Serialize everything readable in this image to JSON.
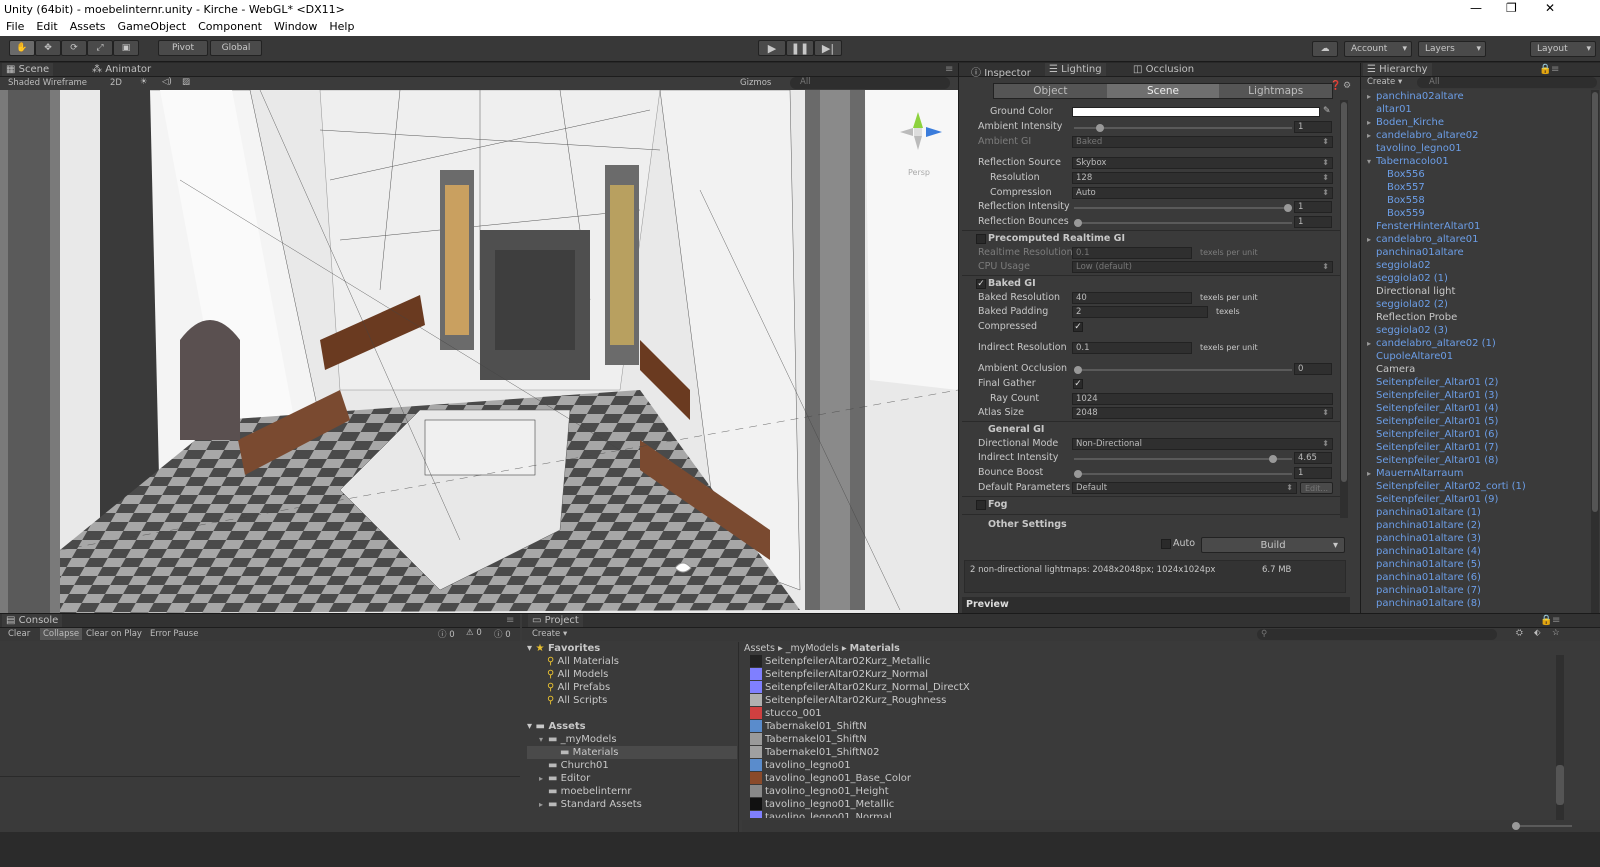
{
  "window": {
    "title": "Unity (64bit) - moebelinternr.unity - Kirche - WebGL* <DX11>"
  },
  "menu": [
    "File",
    "Edit",
    "Assets",
    "GameObject",
    "Component",
    "Window",
    "Help"
  ],
  "toolbar": {
    "pivot": "Pivot",
    "global": "Global",
    "account": "Account",
    "layers": "Layers",
    "layout": "Layout"
  },
  "scene": {
    "tab": "Scene",
    "tab2": "Animator",
    "mode": "Shaded Wireframe",
    "mode2d": "2D",
    "gizmos": "Gizmos",
    "search": "All",
    "persp": "Persp"
  },
  "inspector": {
    "tabs": [
      "Inspector",
      "Lighting",
      "Occlusion"
    ],
    "subtabs": [
      "Object",
      "Scene",
      "Lightmaps"
    ],
    "ground_color": "Ground Color",
    "ambient_intensity": {
      "label": "Ambient Intensity",
      "value": "1"
    },
    "ambient_gi": {
      "label": "Ambient GI",
      "value": "Baked"
    },
    "reflection_source": {
      "label": "Reflection Source",
      "value": "Skybox"
    },
    "resolution": {
      "label": "Resolution",
      "value": "128"
    },
    "compression": {
      "label": "Compression",
      "value": "Auto"
    },
    "reflection_intensity": {
      "label": "Reflection Intensity",
      "value": "1"
    },
    "reflection_bounces": {
      "label": "Reflection Bounces",
      "value": "1"
    },
    "precomputed": "Precomputed Realtime GI",
    "realtime_resolution": {
      "label": "Realtime Resolution",
      "value": "0.1",
      "unit": "texels per unit"
    },
    "cpu_usage": {
      "label": "CPU Usage",
      "value": "Low (default)"
    },
    "baked_gi": "Baked GI",
    "baked_resolution": {
      "label": "Baked Resolution",
      "value": "40",
      "unit": "texels per unit"
    },
    "baked_padding": {
      "label": "Baked Padding",
      "value": "2",
      "unit": "texels"
    },
    "compressed": "Compressed",
    "indirect_resolution": {
      "label": "Indirect Resolution",
      "value": "0.1",
      "unit": "texels per unit"
    },
    "ambient_occlusion": {
      "label": "Ambient Occlusion",
      "value": "0"
    },
    "final_gather": "Final Gather",
    "ray_count": {
      "label": "Ray Count",
      "value": "1024"
    },
    "atlas_size": {
      "label": "Atlas Size",
      "value": "2048"
    },
    "general_gi": "General GI",
    "directional_mode": {
      "label": "Directional Mode",
      "value": "Non-Directional"
    },
    "indirect_intensity": {
      "label": "Indirect Intensity",
      "value": "4.65"
    },
    "bounce_boost": {
      "label": "Bounce Boost",
      "value": "1"
    },
    "default_parameters": {
      "label": "Default Parameters",
      "value": "Default",
      "edit": "Edit..."
    },
    "fog": "Fog",
    "other_settings": "Other Settings",
    "auto": "Auto",
    "build": "Build",
    "status": "2 non-directional lightmaps: 2048x2048px; 1024x1024px",
    "size": "6.7 MB",
    "preview": "Preview"
  },
  "hierarchy": {
    "tab": "Hierarchy",
    "create": "Create",
    "search": "All",
    "items": [
      {
        "label": "panchina02altare",
        "color": "#6c9ee7",
        "indent": 0,
        "arrow": true
      },
      {
        "label": "altar01",
        "color": "#6c9ee7",
        "indent": 0,
        "arrow": false
      },
      {
        "label": "Boden_Kirche",
        "color": "#6c9ee7",
        "indent": 0,
        "arrow": true
      },
      {
        "label": "candelabro_altare02",
        "color": "#6c9ee7",
        "indent": 0,
        "arrow": true
      },
      {
        "label": "tavolino_legno01",
        "color": "#6c9ee7",
        "indent": 0,
        "arrow": false
      },
      {
        "label": "Tabernacolo01",
        "color": "#6c9ee7",
        "indent": 0,
        "arrow": "open"
      },
      {
        "label": "Box556",
        "color": "#6c9ee7",
        "indent": 1,
        "arrow": false
      },
      {
        "label": "Box557",
        "color": "#6c9ee7",
        "indent": 1,
        "arrow": false
      },
      {
        "label": "Box558",
        "color": "#6c9ee7",
        "indent": 1,
        "arrow": false
      },
      {
        "label": "Box559",
        "color": "#6c9ee7",
        "indent": 1,
        "arrow": false
      },
      {
        "label": "FensterHinterAltar01",
        "color": "#6c9ee7",
        "indent": 0,
        "arrow": false
      },
      {
        "label": "candelabro_altare01",
        "color": "#6c9ee7",
        "indent": 0,
        "arrow": true
      },
      {
        "label": "panchina01altare",
        "color": "#6c9ee7",
        "indent": 0,
        "arrow": false
      },
      {
        "label": "seggiola02",
        "color": "#6c9ee7",
        "indent": 0,
        "arrow": false
      },
      {
        "label": "seggiola02 (1)",
        "color": "#6c9ee7",
        "indent": 0,
        "arrow": false
      },
      {
        "label": "Directional light",
        "color": "#c8c8c8",
        "indent": 0,
        "arrow": false
      },
      {
        "label": "seggiola02 (2)",
        "color": "#6c9ee7",
        "indent": 0,
        "arrow": false
      },
      {
        "label": "Reflection Probe",
        "color": "#c8c8c8",
        "indent": 0,
        "arrow": false
      },
      {
        "label": "seggiola02 (3)",
        "color": "#6c9ee7",
        "indent": 0,
        "arrow": false
      },
      {
        "label": "candelabro_altare02 (1)",
        "color": "#6c9ee7",
        "indent": 0,
        "arrow": true
      },
      {
        "label": "CupoleAltare01",
        "color": "#6c9ee7",
        "indent": 0,
        "arrow": false
      },
      {
        "label": "Camera",
        "color": "#c8c8c8",
        "indent": 0,
        "arrow": false
      },
      {
        "label": "Seitenpfeiler_Altar01 (2)",
        "color": "#6c9ee7",
        "indent": 0,
        "arrow": false
      },
      {
        "label": "Seitenpfeiler_Altar01 (3)",
        "color": "#6c9ee7",
        "indent": 0,
        "arrow": false
      },
      {
        "label": "Seitenpfeiler_Altar01 (4)",
        "color": "#6c9ee7",
        "indent": 0,
        "arrow": false
      },
      {
        "label": "Seitenpfeiler_Altar01 (5)",
        "color": "#6c9ee7",
        "indent": 0,
        "arrow": false
      },
      {
        "label": "Seitenpfeiler_Altar01 (6)",
        "color": "#6c9ee7",
        "indent": 0,
        "arrow": false
      },
      {
        "label": "Seitenpfeiler_Altar01 (7)",
        "color": "#6c9ee7",
        "indent": 0,
        "arrow": false
      },
      {
        "label": "Seitenpfeiler_Altar01 (8)",
        "color": "#6c9ee7",
        "indent": 0,
        "arrow": false
      },
      {
        "label": "MauernAltarraum",
        "color": "#6c9ee7",
        "indent": 0,
        "arrow": true
      },
      {
        "label": "Seitenpfeiler_Altar02_corti (1)",
        "color": "#6c9ee7",
        "indent": 0,
        "arrow": false
      },
      {
        "label": "Seitenpfeiler_Altar01 (9)",
        "color": "#6c9ee7",
        "indent": 0,
        "arrow": false
      },
      {
        "label": "panchina01altare (1)",
        "color": "#6c9ee7",
        "indent": 0,
        "arrow": false
      },
      {
        "label": "panchina01altare (2)",
        "color": "#6c9ee7",
        "indent": 0,
        "arrow": false
      },
      {
        "label": "panchina01altare (3)",
        "color": "#6c9ee7",
        "indent": 0,
        "arrow": false
      },
      {
        "label": "panchina01altare (4)",
        "color": "#6c9ee7",
        "indent": 0,
        "arrow": false
      },
      {
        "label": "panchina01altare (5)",
        "color": "#6c9ee7",
        "indent": 0,
        "arrow": false
      },
      {
        "label": "panchina01altare (6)",
        "color": "#6c9ee7",
        "indent": 0,
        "arrow": false
      },
      {
        "label": "panchina01altare (7)",
        "color": "#6c9ee7",
        "indent": 0,
        "arrow": false
      },
      {
        "label": "panchina01altare (8)",
        "color": "#6c9ee7",
        "indent": 0,
        "arrow": false
      }
    ]
  },
  "console": {
    "tab": "Console",
    "buttons": [
      "Clear",
      "Collapse",
      "Clear on Play",
      "Error Pause"
    ],
    "counts": [
      "0",
      "0",
      "0"
    ]
  },
  "project": {
    "tab": "Project",
    "create": "Create",
    "favorites": "Favorites",
    "fav_items": [
      "All Materials",
      "All Models",
      "All Prefabs",
      "All Scripts"
    ],
    "assets": "Assets",
    "tree": [
      {
        "label": "_myModels",
        "indent": 1,
        "arrow": "open",
        "selected": false
      },
      {
        "label": "Materials",
        "indent": 2,
        "arrow": false,
        "selected": true
      },
      {
        "label": "Church01",
        "indent": 1,
        "arrow": false,
        "selected": false
      },
      {
        "label": "Editor",
        "indent": 1,
        "arrow": true,
        "selected": false
      },
      {
        "label": "moebelinternr",
        "indent": 1,
        "arrow": false,
        "selected": false
      },
      {
        "label": "Standard Assets",
        "indent": 1,
        "arrow": true,
        "selected": false
      }
    ],
    "breadcrumb": [
      "Assets",
      "_myModels",
      "Materials"
    ],
    "files": [
      {
        "label": "SeitenpfeilerAltar02Kurz_Metallic",
        "color": "#222222"
      },
      {
        "label": "SeitenpfeilerAltar02Kurz_Normal",
        "color": "#7f7fff"
      },
      {
        "label": "SeitenpfeilerAltar02Kurz_Normal_DirectX",
        "color": "#8080ff"
      },
      {
        "label": "SeitenpfeilerAltar02Kurz_Roughness",
        "color": "#b0b0b0"
      },
      {
        "label": "stucco_001",
        "color": "#d04040"
      },
      {
        "label": "Tabernakel01_ShiftN",
        "color": "#5a8ccc"
      },
      {
        "label": "Tabernakel01_ShiftN",
        "color": "#9a9a9a"
      },
      {
        "label": "Tabernakel01_ShiftN02",
        "color": "#a0a0a0"
      },
      {
        "label": "tavolino_legno01",
        "color": "#5a8ccc"
      },
      {
        "label": "tavolino_legno01_Base_Color",
        "color": "#8a4a2a"
      },
      {
        "label": "tavolino_legno01_Height",
        "color": "#888888"
      },
      {
        "label": "tavolino_legno01_Metallic",
        "color": "#111111"
      },
      {
        "label": "tavolino_legno01_Normal",
        "color": "#8080ff"
      }
    ]
  }
}
